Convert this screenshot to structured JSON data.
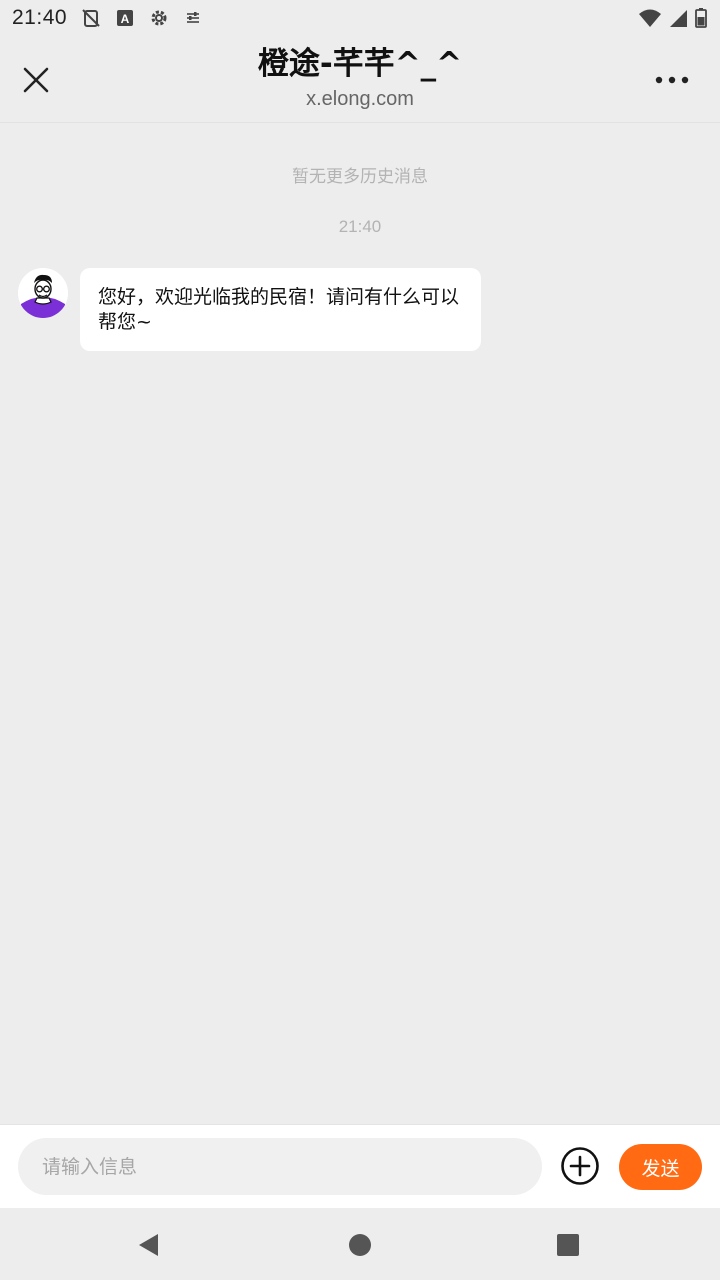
{
  "status_bar": {
    "time": "21:40",
    "icons_left": [
      "no-sim-icon",
      "keyboard-a-icon",
      "settings-gear-icon",
      "tune-icon"
    ],
    "icons_right": [
      "wifi-icon",
      "signal-icon",
      "battery-icon"
    ]
  },
  "header": {
    "title": "橙途-芊芊^_^",
    "subtitle": "x.elong.com",
    "close_icon": "close-icon",
    "more_icon": "more-icon"
  },
  "chat": {
    "history_note": "暂无更多历史消息",
    "timestamp": "21:40",
    "messages": [
      {
        "sender": "host",
        "text": "您好，欢迎光临我的民宿！请问有什么可以帮您~"
      }
    ]
  },
  "input_bar": {
    "placeholder": "请输入信息",
    "value": "",
    "send_label": "发送"
  },
  "colors": {
    "accent": "#ff6a13",
    "background": "#ededed",
    "bubble": "#ffffff",
    "avatar_shirt": "#7b2fd6"
  }
}
